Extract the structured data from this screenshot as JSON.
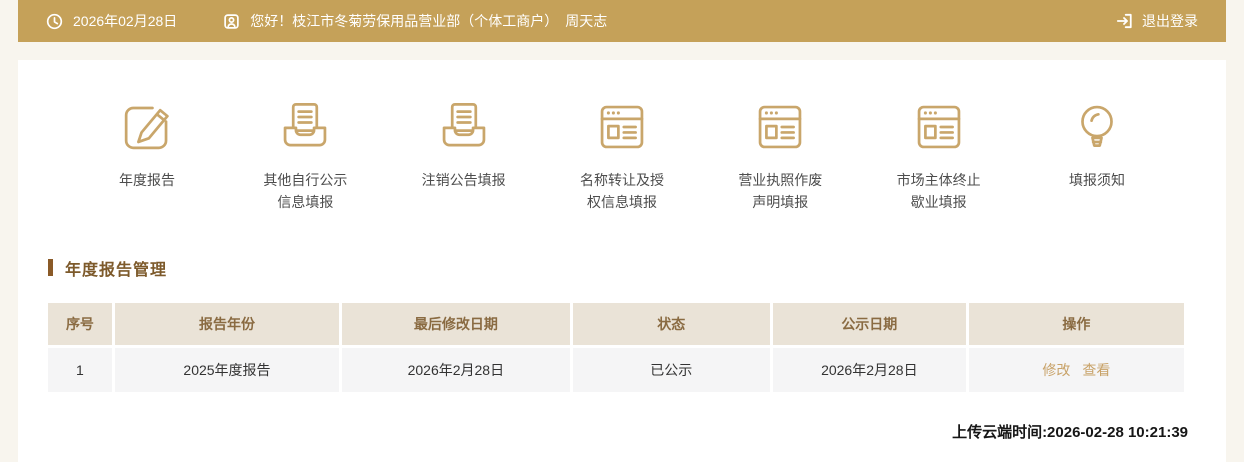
{
  "colors": {
    "accent_gold": "#C5A159",
    "icon_gold": "#C9A66B",
    "page_background": "#F8F5EE",
    "section_bar_brown": "#8A5A28",
    "section_title_brown": "#7D5A2B",
    "table_header_bg": "#EAE3D7",
    "table_header_text": "#8A6B42",
    "link_gold": "#C8A268"
  },
  "header": {
    "date": "2026年02月28日",
    "greeting": "您好！枝江市冬菊劳保用品营业部（个体工商户）　周天志",
    "logout_label": "退出登录"
  },
  "nav": {
    "items": [
      {
        "label": "年度报告",
        "icon": "edit-icon"
      },
      {
        "label": "其他自行公示信息填报",
        "icon": "inbox-document-icon"
      },
      {
        "label": "注销公告填报",
        "icon": "inbox-document-icon"
      },
      {
        "label": "名称转让及授权信息填报",
        "icon": "browser-window-icon"
      },
      {
        "label": "营业执照作废声明填报",
        "icon": "browser-window-icon"
      },
      {
        "label": "市场主体终止歇业填报",
        "icon": "browser-window-icon"
      },
      {
        "label": "填报须知",
        "icon": "lightbulb-icon"
      }
    ]
  },
  "section": {
    "title": "年度报告管理"
  },
  "table": {
    "headers": [
      "序号",
      "报告年份",
      "最后修改日期",
      "状态",
      "公示日期",
      "操作"
    ],
    "rows": [
      {
        "seq": "1",
        "report_year": "2025年度报告",
        "last_modified": "2026年2月28日",
        "status": "已公示",
        "publish_date": "2026年2月28日",
        "actions": [
          "修改",
          "查看"
        ]
      }
    ]
  },
  "footer": {
    "upload_time": "上传云端时间:2026-02-28 10:21:39"
  }
}
